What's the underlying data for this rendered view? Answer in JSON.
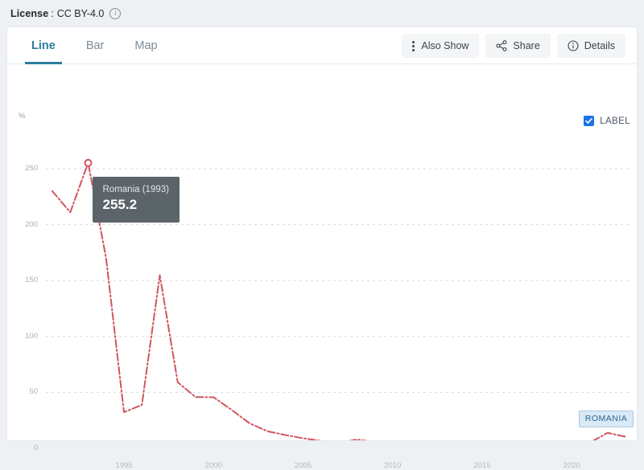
{
  "license": {
    "label": "License",
    "separator": ":",
    "value": "CC BY-4.0",
    "info_icon": "info-circle-icon"
  },
  "tabs": [
    {
      "id": "line",
      "label": "Line",
      "active": true
    },
    {
      "id": "bar",
      "label": "Bar",
      "active": false
    },
    {
      "id": "map",
      "label": "Map",
      "active": false
    }
  ],
  "toolbar": {
    "also_show_label": "Also Show",
    "also_show_icon": "kebab-menu-icon",
    "share_label": "Share",
    "share_icon": "share-icon",
    "details_label": "Details",
    "details_icon": "info-circle-icon"
  },
  "legend": {
    "checkbox_checked": true,
    "label": "LABEL"
  },
  "tooltip": {
    "title": "Romania (1993)",
    "value": "255.2"
  },
  "series_label": {
    "text": "ROMANIA",
    "background": "#d9e9f5",
    "border": "#a9c9e2",
    "color": "#2f6690"
  },
  "colors": {
    "accent_tab": "#2d7d9c",
    "line": "#cf5560",
    "checkbox": "#1a73e8",
    "tooltip_bg": "#5b6469",
    "page_bg": "#eef1f4",
    "card_bg": "#ffffff"
  },
  "chart_data": {
    "type": "line",
    "title": "",
    "xlabel": "",
    "ylabel": "%",
    "xlim": [
      1991,
      2023
    ],
    "ylim": [
      0,
      265
    ],
    "yticks": [
      0,
      50,
      100,
      150,
      200,
      250
    ],
    "xticks": [
      1995,
      2000,
      2005,
      2010,
      2015,
      2020
    ],
    "grid": true,
    "legend_position": "inline-label-right",
    "series": [
      {
        "name": "Romania",
        "color": "#cf5560",
        "style": "dash-dot",
        "x": [
          1991,
          1992,
          1993,
          1994,
          1995,
          1996,
          1997,
          1998,
          1999,
          2000,
          2001,
          2002,
          2003,
          2004,
          2005,
          2006,
          2007,
          2008,
          2009,
          2010,
          2011,
          2012,
          2013,
          2014,
          2015,
          2016,
          2017,
          2018,
          2019,
          2020,
          2021,
          2022,
          2023
        ],
        "values": [
          230.0,
          211.0,
          255.2,
          170.2,
          32.3,
          38.8,
          154.8,
          59.1,
          45.8,
          45.7,
          34.5,
          22.5,
          15.3,
          11.9,
          9.0,
          6.6,
          4.8,
          7.9,
          5.6,
          6.1,
          5.8,
          3.3,
          4.0,
          1.1,
          -0.6,
          -1.5,
          1.3,
          4.6,
          3.8,
          2.6,
          5.0,
          13.8,
          10.4
        ]
      }
    ],
    "highlight_point": {
      "x": 1993,
      "y": 255.2
    }
  }
}
